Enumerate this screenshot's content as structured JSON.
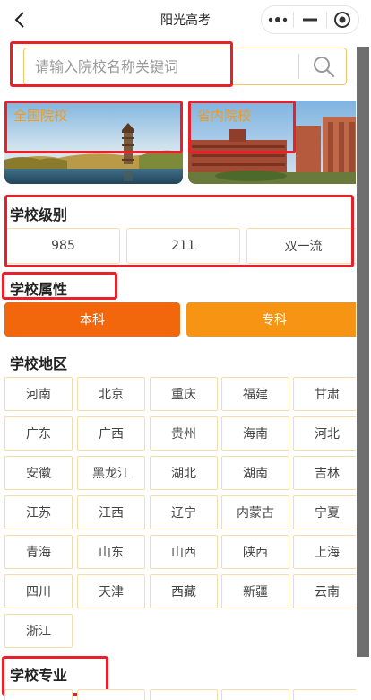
{
  "nav": {
    "title": "阳光高考"
  },
  "search": {
    "placeholder": "请输入院校名称关键词"
  },
  "cards": [
    {
      "label": "全国院校"
    },
    {
      "label": "省内院校"
    }
  ],
  "level": {
    "title": "学校级别",
    "options": [
      "985",
      "211",
      "双一流"
    ]
  },
  "attr": {
    "title": "学校属性",
    "options": [
      "本科",
      "专科"
    ]
  },
  "region": {
    "title": "学校地区",
    "items": [
      "河南",
      "北京",
      "重庆",
      "福建",
      "甘肃",
      "广东",
      "广西",
      "贵州",
      "海南",
      "河北",
      "安徽",
      "黑龙江",
      "湖北",
      "湖南",
      "吉林",
      "江苏",
      "江西",
      "辽宁",
      "内蒙古",
      "宁夏",
      "青海",
      "山东",
      "山西",
      "陕西",
      "上海",
      "四川",
      "天津",
      "西藏",
      "新疆",
      "云南",
      "浙江"
    ]
  },
  "major": {
    "title": "学校专业"
  },
  "colors": {
    "accent": "#f39a1e",
    "benke": "#f2670c",
    "zhuanke": "#f79413",
    "highlight": "#e8202a",
    "border": "#f5dca8"
  },
  "icons": {
    "back": "chevron-left-icon",
    "more": "more-dots-icon",
    "minimize": "minimize-icon",
    "close": "target-close-icon",
    "search": "search-icon"
  }
}
